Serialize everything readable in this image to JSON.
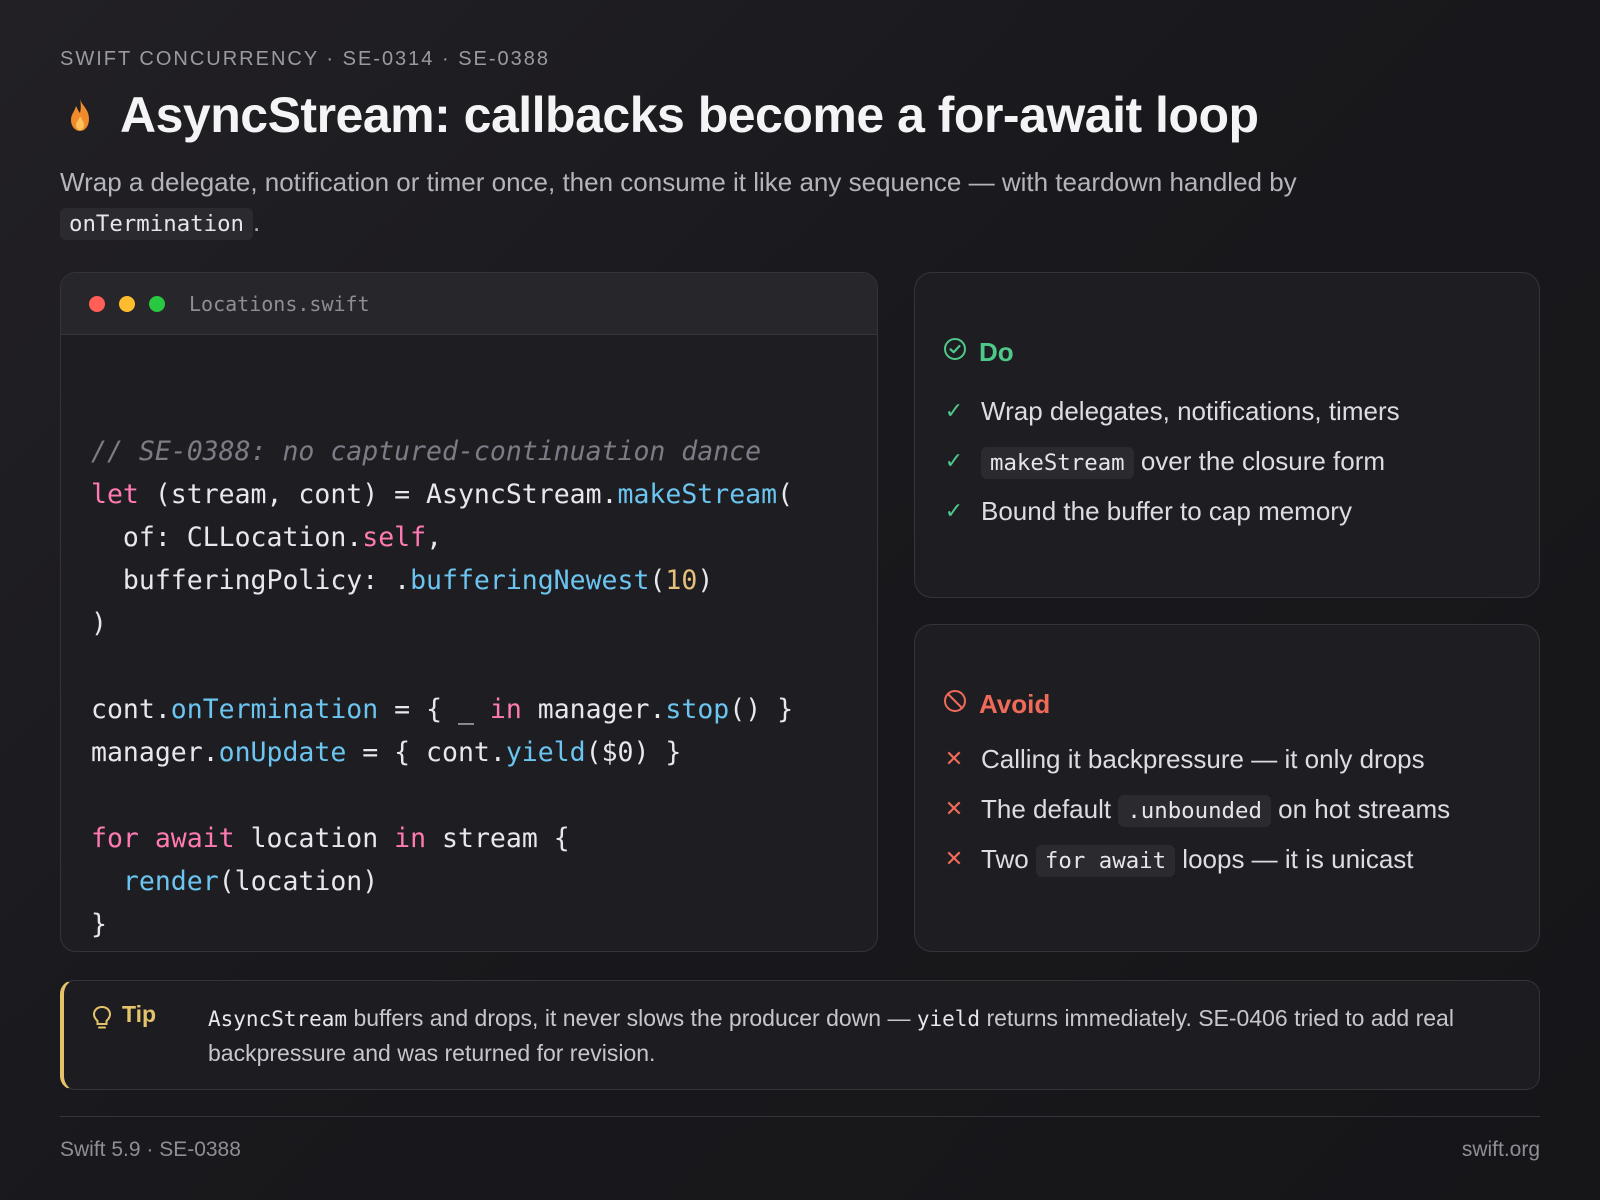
{
  "header": {
    "eyebrow": "SWIFT CONCURRENCY · SE-0314 · SE-0388",
    "title": "AsyncStream: callbacks become a for-await loop",
    "subtitle_text": "Wrap a delegate, notification or timer once, then consume it like any sequence — with teardown handled by",
    "subtitle_code": "onTermination",
    "subtitle_end": "."
  },
  "code": {
    "filename": "Locations.swift",
    "lines": [
      [],
      [
        {
          "t": "// SE-0388: no captured-continuation dance",
          "c": "comment"
        }
      ],
      [
        {
          "t": "let",
          "c": "kw"
        },
        {
          "t": " (stream, cont) = AsyncStream.",
          "c": "plain"
        },
        {
          "t": "makeStream",
          "c": "fn"
        },
        {
          "t": "(",
          "c": "plain"
        }
      ],
      [
        {
          "t": "  of: CLLocation.",
          "c": "plain"
        },
        {
          "t": "self",
          "c": "kw"
        },
        {
          "t": ",",
          "c": "plain"
        }
      ],
      [
        {
          "t": "  bufferingPolicy: .",
          "c": "plain"
        },
        {
          "t": "bufferingNewest",
          "c": "fn"
        },
        {
          "t": "(",
          "c": "plain"
        },
        {
          "t": "10",
          "c": "num"
        },
        {
          "t": ")",
          "c": "plain"
        }
      ],
      [
        {
          "t": ")",
          "c": "plain"
        }
      ],
      [],
      [
        {
          "t": "cont.",
          "c": "plain"
        },
        {
          "t": "onTermination",
          "c": "fn"
        },
        {
          "t": " = { _ ",
          "c": "plain"
        },
        {
          "t": "in",
          "c": "kw"
        },
        {
          "t": " manager.",
          "c": "plain"
        },
        {
          "t": "stop",
          "c": "fn"
        },
        {
          "t": "() }",
          "c": "plain"
        }
      ],
      [
        {
          "t": "manager.",
          "c": "plain"
        },
        {
          "t": "onUpdate",
          "c": "fn"
        },
        {
          "t": " = { cont.",
          "c": "plain"
        },
        {
          "t": "yield",
          "c": "fn"
        },
        {
          "t": "($0) }",
          "c": "plain"
        }
      ],
      [],
      [
        {
          "t": "for",
          "c": "kw"
        },
        {
          "t": " ",
          "c": "plain"
        },
        {
          "t": "await",
          "c": "kw"
        },
        {
          "t": " location ",
          "c": "plain"
        },
        {
          "t": "in",
          "c": "kw"
        },
        {
          "t": " stream {",
          "c": "plain"
        }
      ],
      [
        {
          "t": "  ",
          "c": "plain"
        },
        {
          "t": "render",
          "c": "fn"
        },
        {
          "t": "(location)",
          "c": "plain"
        }
      ],
      [
        {
          "t": "}",
          "c": "plain"
        }
      ]
    ]
  },
  "do_card": {
    "title": "Do",
    "items": [
      [
        {
          "t": "Wrap delegates, notifications, timers",
          "c": "text"
        }
      ],
      [
        {
          "t": "makeStream",
          "c": "chip"
        },
        {
          "t": " over the closure form",
          "c": "text"
        }
      ],
      [
        {
          "t": "Bound the buffer to cap memory",
          "c": "text"
        }
      ]
    ]
  },
  "avoid_card": {
    "title": "Avoid",
    "items": [
      [
        {
          "t": "Calling it backpressure — it only drops",
          "c": "text"
        }
      ],
      [
        {
          "t": "The default ",
          "c": "text"
        },
        {
          "t": ".unbounded",
          "c": "chip"
        },
        {
          "t": " on hot streams",
          "c": "text"
        }
      ],
      [
        {
          "t": "Two ",
          "c": "text"
        },
        {
          "t": "for await",
          "c": "chip"
        },
        {
          "t": " loops — it is unicast",
          "c": "text"
        }
      ]
    ]
  },
  "tip": {
    "label": "Tip",
    "parts": [
      {
        "t": "AsyncStream",
        "c": "mono"
      },
      {
        "t": " buffers and drops, it never slows the producer down — ",
        "c": "text"
      },
      {
        "t": "yield",
        "c": "mono"
      },
      {
        "t": " returns immediately. SE-0406 tried to add real backpressure and was returned for revision.",
        "c": "text"
      }
    ]
  },
  "footer": {
    "left": "Swift 5.9 · SE-0388",
    "right": "swift.org"
  },
  "colors": {
    "accent_do": "#4ec98a",
    "accent_avoid": "#f06a5a",
    "accent_tip": "#e4c36a",
    "code_keyword": "#ff7ab2",
    "code_function": "#6bc5f0",
    "code_number": "#e5c07b"
  }
}
